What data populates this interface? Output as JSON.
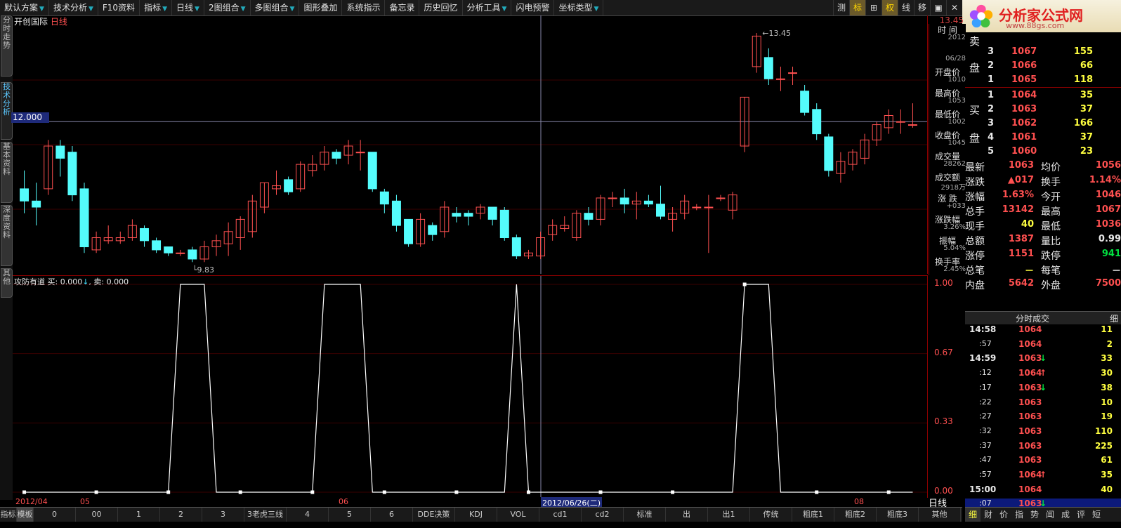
{
  "toolbar": {
    "items": [
      {
        "label": "默认方案",
        "arrow": true
      },
      {
        "label": "技术分析",
        "arrow": true
      },
      {
        "label": "F10资料",
        "arrow": false
      },
      {
        "label": "指标",
        "arrow": true
      },
      {
        "label": "日线",
        "arrow": true
      },
      {
        "label": "2图组合",
        "arrow": true
      },
      {
        "label": "多图组合",
        "arrow": true
      },
      {
        "label": "图形叠加",
        "arrow": false
      },
      {
        "label": "系统指示",
        "arrow": false
      },
      {
        "label": "备忘录",
        "arrow": false
      },
      {
        "label": "历史回忆",
        "arrow": false
      },
      {
        "label": "分析工具",
        "arrow": true
      },
      {
        "label": "闪电预警",
        "arrow": false
      },
      {
        "label": "坐标类型",
        "arrow": true
      }
    ],
    "right_buttons": [
      "测",
      "标",
      "⊞",
      "权",
      "线",
      "移",
      "▣",
      "✕"
    ]
  },
  "logo": {
    "name": "分析家公式网",
    "url": "www.88gs.com"
  },
  "left_tabs": [
    "分时走势",
    "技术分析",
    "基本资料",
    "深度资料",
    "其他"
  ],
  "main_chart": {
    "stock_name": "开创国际",
    "period": "日线",
    "cursor_price": "12.000",
    "high_label": "13.45",
    "low_label": "9.83",
    "y_top_label": "13.45"
  },
  "sub_chart": {
    "title": "攻防有道",
    "buy_label": "买: 0.000",
    "sell_label": "卖: 0.000",
    "y_ticks": [
      "1.00",
      "0.67",
      "0.33",
      "0.00"
    ]
  },
  "chart_data": {
    "type": "line",
    "title": "攻防有道",
    "series": [
      {
        "name": "买",
        "values": [
          0,
          0,
          0,
          0,
          0,
          0,
          0,
          0,
          0,
          0,
          0,
          0,
          0,
          1,
          1,
          1,
          0,
          0,
          0,
          0,
          0,
          0,
          0,
          0,
          0,
          1,
          1,
          1,
          1,
          0,
          0,
          0,
          0,
          0,
          0,
          0,
          0,
          0,
          0,
          0,
          0,
          1,
          0,
          0,
          0,
          0,
          0,
          0,
          0,
          0,
          0,
          0,
          0,
          0,
          0,
          0,
          0,
          0,
          0,
          0,
          1,
          1,
          1,
          0,
          0,
          0,
          0,
          0,
          0,
          0,
          0,
          0,
          0,
          0,
          0
        ]
      }
    ],
    "ylim": [
      0,
      1
    ]
  },
  "candles": [
    {
      "o": 10.9,
      "c": 10.7,
      "h": 11.2,
      "l": 10.5
    },
    {
      "o": 10.7,
      "c": 10.6,
      "h": 11.0,
      "l": 10.3
    },
    {
      "o": 10.9,
      "c": 11.6,
      "h": 11.7,
      "l": 10.8
    },
    {
      "o": 11.6,
      "c": 11.4,
      "h": 11.7,
      "l": 11.1
    },
    {
      "o": 11.5,
      "c": 10.8,
      "h": 11.6,
      "l": 10.7
    },
    {
      "o": 10.9,
      "c": 9.95,
      "h": 11.0,
      "l": 9.85
    },
    {
      "o": 9.9,
      "c": 10.1,
      "h": 10.2,
      "l": 9.85
    },
    {
      "o": 10.05,
      "c": 10.1,
      "h": 10.3,
      "l": 10.0
    },
    {
      "o": 10.05,
      "c": 10.1,
      "h": 10.2,
      "l": 10.0
    },
    {
      "o": 10.1,
      "c": 10.3,
      "h": 10.4,
      "l": 10.05
    },
    {
      "o": 10.25,
      "c": 10.05,
      "h": 10.3,
      "l": 9.95
    },
    {
      "o": 10.05,
      "c": 9.9,
      "h": 10.1,
      "l": 9.85
    },
    {
      "o": 9.95,
      "c": 9.85,
      "h": 9.95,
      "l": 9.8
    },
    {
      "o": 9.85,
      "c": 9.85,
      "h": 9.9,
      "l": 9.8
    },
    {
      "o": 9.9,
      "c": 9.75,
      "h": 9.95,
      "l": 9.7
    },
    {
      "o": 9.75,
      "c": 9.95,
      "h": 10.05,
      "l": 9.7
    },
    {
      "o": 9.95,
      "c": 10.05,
      "h": 10.15,
      "l": 9.8
    },
    {
      "o": 10.0,
      "c": 10.2,
      "h": 10.35,
      "l": 9.8
    },
    {
      "o": 10.1,
      "c": 10.4,
      "h": 10.45,
      "l": 9.9
    },
    {
      "o": 10.2,
      "c": 10.7,
      "h": 10.8,
      "l": 10.1
    },
    {
      "o": 10.6,
      "c": 11.0,
      "h": 11.0,
      "l": 10.5
    },
    {
      "o": 10.9,
      "c": 10.95,
      "h": 11.2,
      "l": 10.8
    },
    {
      "o": 11.05,
      "c": 10.85,
      "h": 11.1,
      "l": 10.8
    },
    {
      "o": 10.9,
      "c": 11.3,
      "h": 11.35,
      "l": 10.85
    },
    {
      "o": 11.2,
      "c": 11.3,
      "h": 11.45,
      "l": 11.1
    },
    {
      "o": 11.3,
      "c": 11.5,
      "h": 11.6,
      "l": 11.2
    },
    {
      "o": 11.5,
      "c": 11.4,
      "h": 11.55,
      "l": 11.3
    },
    {
      "o": 11.45,
      "c": 11.6,
      "h": 11.7,
      "l": 11.3
    },
    {
      "o": 11.5,
      "c": 11.5,
      "h": 11.7,
      "l": 11.2
    },
    {
      "o": 11.5,
      "c": 10.9,
      "h": 11.5,
      "l": 10.85
    },
    {
      "o": 10.85,
      "c": 10.65,
      "h": 10.9,
      "l": 10.5
    },
    {
      "o": 10.7,
      "c": 10.3,
      "h": 10.8,
      "l": 10.2
    },
    {
      "o": 10.4,
      "c": 10.0,
      "h": 10.4,
      "l": 9.95
    },
    {
      "o": 10.0,
      "c": 10.4,
      "h": 10.5,
      "l": 9.95
    },
    {
      "o": 10.3,
      "c": 10.15,
      "h": 10.35,
      "l": 10.05
    },
    {
      "o": 10.2,
      "c": 10.6,
      "h": 10.7,
      "l": 10.1
    },
    {
      "o": 10.5,
      "c": 10.45,
      "h": 10.6,
      "l": 10.35
    },
    {
      "o": 10.5,
      "c": 10.45,
      "h": 10.55,
      "l": 10.3
    },
    {
      "o": 10.5,
      "c": 10.6,
      "h": 10.65,
      "l": 10.4
    },
    {
      "o": 10.6,
      "c": 10.4,
      "h": 10.6,
      "l": 10.3
    },
    {
      "o": 10.55,
      "c": 10.1,
      "h": 10.6,
      "l": 10.05
    },
    {
      "o": 10.1,
      "c": 9.8,
      "h": 10.15,
      "l": 9.75
    },
    {
      "o": 9.8,
      "c": 9.85,
      "h": 9.9,
      "l": 9.75
    },
    {
      "o": 9.8,
      "c": 10.1,
      "h": 10.2,
      "l": 9.75
    },
    {
      "o": 10.15,
      "c": 10.3,
      "h": 10.4,
      "l": 10.05
    },
    {
      "o": 10.25,
      "c": 10.3,
      "h": 10.45,
      "l": 10.2
    },
    {
      "o": 10.1,
      "c": 10.5,
      "h": 10.55,
      "l": 10.05
    },
    {
      "o": 10.5,
      "c": 10.4,
      "h": 10.6,
      "l": 10.3
    },
    {
      "o": 10.4,
      "c": 10.75,
      "h": 10.8,
      "l": 10.3
    },
    {
      "o": 10.75,
      "c": 10.75,
      "h": 10.85,
      "l": 10.6
    },
    {
      "o": 10.75,
      "c": 10.65,
      "h": 10.9,
      "l": 10.5
    },
    {
      "o": 10.65,
      "c": 10.7,
      "h": 10.85,
      "l": 10.4
    },
    {
      "o": 10.7,
      "c": 10.65,
      "h": 10.8,
      "l": 10.6
    },
    {
      "o": 10.65,
      "c": 10.45,
      "h": 10.95,
      "l": 10.4
    },
    {
      "o": 10.4,
      "c": 10.5,
      "h": 10.6,
      "l": 10.2
    },
    {
      "o": 10.5,
      "c": 10.7,
      "h": 10.8,
      "l": 10.4
    },
    {
      "o": 10.6,
      "c": 10.6,
      "h": 10.65,
      "l": 10.55
    },
    {
      "o": 10.6,
      "c": 10.6,
      "h": 10.8,
      "l": 9.85
    },
    {
      "o": 10.75,
      "c": 10.75,
      "h": 10.8,
      "l": 10.7
    },
    {
      "o": 10.55,
      "c": 10.8,
      "h": 10.85,
      "l": 10.4
    },
    {
      "o": 11.6,
      "c": 12.4,
      "h": 12.4,
      "l": 11.5
    },
    {
      "o": 12.9,
      "c": 13.4,
      "h": 13.45,
      "l": 12.8
    },
    {
      "o": 13.05,
      "c": 12.7,
      "h": 13.2,
      "l": 12.6
    },
    {
      "o": 12.7,
      "c": 12.7,
      "h": 12.9,
      "l": 12.5
    },
    {
      "o": 12.8,
      "c": 12.8,
      "h": 12.9,
      "l": 12.6
    },
    {
      "o": 12.5,
      "c": 12.15,
      "h": 12.6,
      "l": 12.1
    },
    {
      "o": 12.2,
      "c": 11.8,
      "h": 12.3,
      "l": 11.7
    },
    {
      "o": 11.75,
      "c": 11.2,
      "h": 11.8,
      "l": 11.1
    },
    {
      "o": 11.15,
      "c": 11.35,
      "h": 11.5,
      "l": 11.0
    },
    {
      "o": 11.3,
      "c": 11.5,
      "h": 11.55,
      "l": 11.2
    },
    {
      "o": 11.4,
      "c": 11.7,
      "h": 11.8,
      "l": 11.3
    },
    {
      "o": 11.7,
      "c": 11.95,
      "h": 12.0,
      "l": 11.6
    },
    {
      "o": 11.9,
      "c": 12.1,
      "h": 12.2,
      "l": 11.8
    },
    {
      "o": 12.0,
      "c": 12.0,
      "h": 12.2,
      "l": 11.8
    },
    {
      "o": 11.95,
      "c": 11.95,
      "h": 12.3,
      "l": 11.9
    }
  ],
  "info_panel": [
    {
      "label": "时 间",
      "value": "2012"
    },
    {
      "label": "",
      "value": "06/28"
    },
    {
      "label": "开盘价",
      "value": "1010"
    },
    {
      "label": "最高价",
      "value": "1053"
    },
    {
      "label": "最低价",
      "value": "1002"
    },
    {
      "label": "收盘价",
      "value": "1045"
    },
    {
      "label": "成交量",
      "value": "28262"
    },
    {
      "label": "成交额",
      "value": "2918万"
    },
    {
      "label": "涨 跌",
      "value": "+033"
    },
    {
      "label": "涨跌幅",
      "value": "3.26%"
    },
    {
      "label": "振幅",
      "value": "5.04%"
    },
    {
      "label": "换手率",
      "value": "2.45%"
    }
  ],
  "sell_book": [
    {
      "n": "3",
      "price": "1067",
      "vol": "155"
    },
    {
      "n": "2",
      "price": "1066",
      "vol": "66"
    },
    {
      "n": "1",
      "price": "1065",
      "vol": "118"
    }
  ],
  "buy_book": [
    {
      "n": "1",
      "price": "1064",
      "vol": "35"
    },
    {
      "n": "2",
      "price": "1063",
      "vol": "37"
    },
    {
      "n": "3",
      "price": "1062",
      "vol": "166"
    },
    {
      "n": "4",
      "price": "1061",
      "vol": "37"
    },
    {
      "n": "5",
      "price": "1060",
      "vol": "23"
    }
  ],
  "book_labels": {
    "sell_a": "卖",
    "sell_b": "盘",
    "buy_a": "买",
    "buy_b": "盘"
  },
  "quote": [
    {
      "l1": "最新",
      "v1": "1063",
      "l2": "均价",
      "v2": "1056"
    },
    {
      "l1": "涨跌",
      "v1": "▲017",
      "l2": "换手",
      "v2": "1.14%"
    },
    {
      "l1": "涨幅",
      "v1": "1.63%",
      "l2": "今开",
      "v2": "1046"
    },
    {
      "l1": "总手",
      "v1": "13142",
      "l2": "最高",
      "v2": "1067"
    },
    {
      "l1": "现手",
      "v1": "40",
      "l2": "最低",
      "v2": "1036"
    },
    {
      "l1": "总额",
      "v1": "1387",
      "l2": "量比",
      "v2": "0.99"
    },
    {
      "l1": "涨停",
      "v1": "1151",
      "l2": "跌停",
      "v2": "941"
    },
    {
      "l1": "总笔",
      "v1": "－",
      "l2": "每笔",
      "v2": "－"
    },
    {
      "l1": "内盘",
      "v1": "5642",
      "l2": "外盘",
      "v2": "7500"
    }
  ],
  "ticks_header": {
    "title": "分时成交",
    "tab": "细"
  },
  "ticks": [
    {
      "t": "14:58",
      "p": "1064",
      "a": "",
      "v": "11"
    },
    {
      "t": ":57",
      "p": "1064",
      "a": "",
      "v": "2"
    },
    {
      "t": "14:59",
      "p": "1063",
      "a": "↓",
      "v": "33"
    },
    {
      "t": ":12",
      "p": "1064",
      "a": "↑",
      "v": "30"
    },
    {
      "t": ":17",
      "p": "1063",
      "a": "↓",
      "v": "38"
    },
    {
      "t": ":22",
      "p": "1063",
      "a": "",
      "v": "10"
    },
    {
      "t": ":27",
      "p": "1063",
      "a": "",
      "v": "19"
    },
    {
      "t": ":32",
      "p": "1063",
      "a": "",
      "v": "110"
    },
    {
      "t": ":37",
      "p": "1063",
      "a": "",
      "v": "225"
    },
    {
      "t": ":47",
      "p": "1063",
      "a": "",
      "v": "61"
    },
    {
      "t": ":57",
      "p": "1064",
      "a": "↑",
      "v": "35"
    },
    {
      "t": "15:00",
      "p": "1064",
      "a": "",
      "v": "40"
    },
    {
      "t": ":07",
      "p": "1063",
      "a": "↓",
      "v": ""
    }
  ],
  "date_bar": {
    "labels": [
      "2012/04",
      "05",
      "06",
      "08"
    ],
    "cursor_date": "2012/06/26(二)",
    "period_label": "日线"
  },
  "bottom_tabs": [
    "指标",
    "模板",
    "0",
    "00",
    "1",
    "2",
    "3",
    "3老虎三线",
    "4",
    "5",
    "6",
    "DDE决策",
    "KDJ",
    "VOL",
    "cd1",
    "cd2",
    "标准",
    "出",
    "出1",
    "传统",
    "粗底1",
    "粗底2",
    "粗底3",
    "其他"
  ],
  "right_bottom_tabs": [
    "细",
    "财",
    "价",
    "指",
    "势",
    "闻",
    "成",
    "评",
    "短"
  ],
  "colors": {
    "up": "#ff5050",
    "down": "#54fcfc",
    "grid": "#800000",
    "panel_bg": "#000000"
  }
}
